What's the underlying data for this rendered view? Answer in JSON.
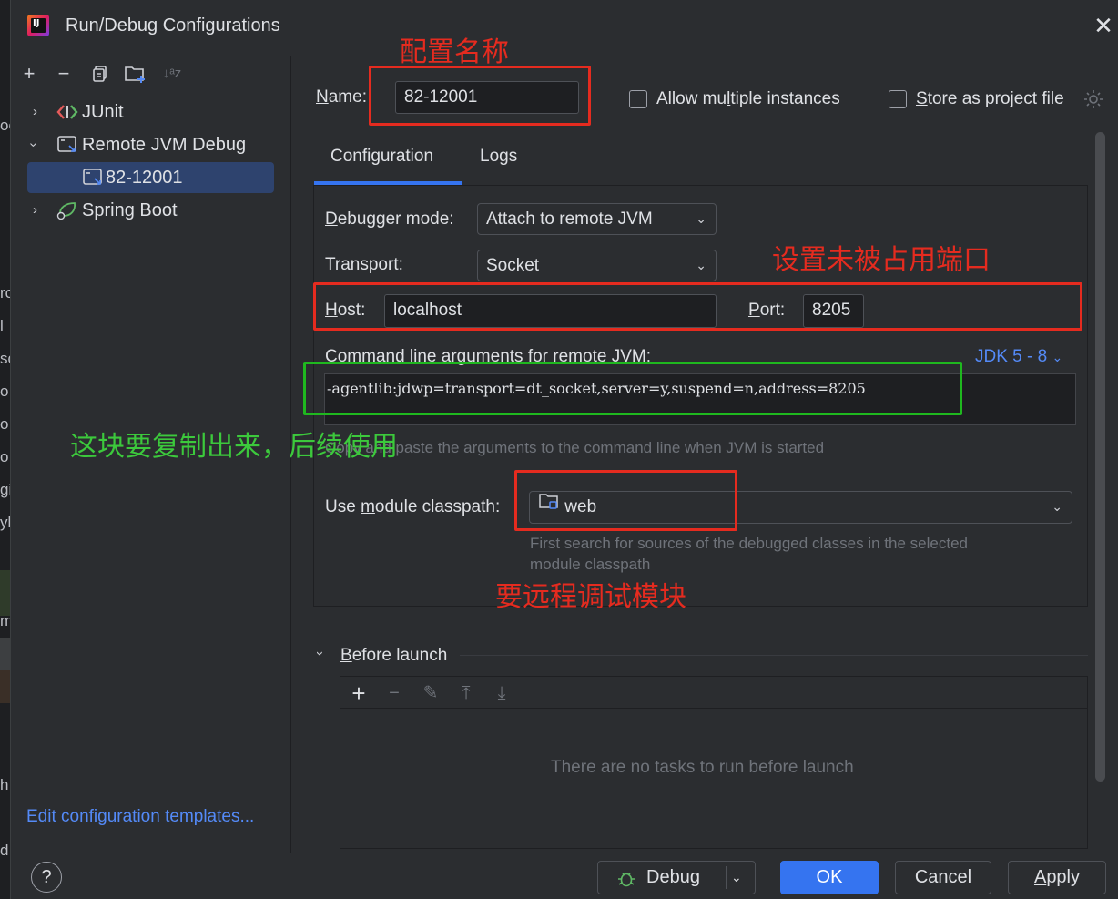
{
  "window": {
    "title": "Run/Debug Configurations",
    "icon_text": "IJ"
  },
  "ide_strip": [
    "oc",
    "ro",
    "l",
    "sc",
    "o",
    "o",
    "o",
    "gi",
    "yb",
    "m",
    "h",
    "d"
  ],
  "sidebar": {
    "toolbar": [
      "add-icon",
      "remove-icon",
      "copy-icon",
      "folder-add-icon",
      "sort-icon"
    ],
    "items": [
      {
        "label": "JUnit",
        "icon": "junit-icon",
        "expanded": false
      },
      {
        "label": "Remote JVM Debug",
        "icon": "remote-debug-icon",
        "expanded": true
      },
      {
        "label": "82-12001",
        "icon": "remote-debug-icon",
        "selected": true
      },
      {
        "label": "Spring Boot",
        "icon": "spring-boot-icon",
        "expanded": false
      }
    ],
    "edit_templates": "Edit configuration templates..."
  },
  "name_field": {
    "label_prefix": "N",
    "label_rest": "ame:",
    "value": "82-12001"
  },
  "checkboxes": {
    "allow_multiple_a": "Allow mu",
    "allow_multiple_u": "l",
    "allow_multiple_b": "tiple instances",
    "store_a": "S",
    "store_b": "tore as project file"
  },
  "tabs": [
    "Configuration",
    "Logs"
  ],
  "config": {
    "debugger_mode_u": "D",
    "debugger_mode_rest": "ebugger mode:",
    "debugger_mode_value": "Attach to remote JVM",
    "transport_u": "T",
    "transport_rest": "ransport:",
    "transport_value": "Socket",
    "host_u": "H",
    "host_rest": "ost:",
    "host_value": "localhost",
    "port_u": "P",
    "port_rest": "ort:",
    "port_value": "8205",
    "cmd_label": "Command line arguments for remote JVM:",
    "jdk_link": "JDK 5 - 8",
    "cmd_value": "-agentlib:jdwp=transport=dt_socket,server=y,suspend=n,address=8205",
    "cmd_hint": "Copy and paste the arguments to the command line when JVM is started",
    "module_label_a": "Use ",
    "module_label_u": "m",
    "module_label_b": "odule classpath:",
    "module_value": "web",
    "module_hint_1": "First search for sources of the debugged classes in the selected",
    "module_hint_2": "module classpath"
  },
  "before_launch": {
    "title_u": "B",
    "title_rest": "efore launch",
    "empty_text": "There are no tasks to run before launch"
  },
  "buttons": {
    "help": "?",
    "debug": "Debug",
    "ok": "OK",
    "cancel": "Cancel",
    "apply_u": "A",
    "apply_rest": "pply"
  },
  "annotations": {
    "name": "配置名称",
    "port": "设置未被占用端口",
    "args": "这块要复制出来，后续使用",
    "module": "要远程调试模块"
  },
  "colors": {
    "accent": "#3574f0",
    "link": "#548af7",
    "annotation_red": "#e52b1f",
    "annotation_green": "#1fb81f"
  }
}
